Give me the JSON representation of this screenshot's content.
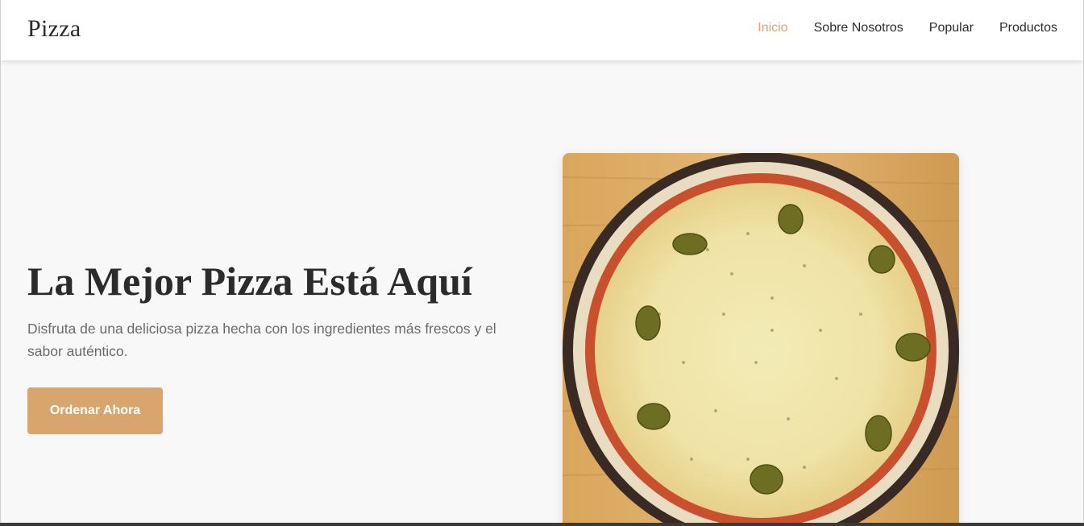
{
  "brand": {
    "logo_text": "Pizza"
  },
  "nav": {
    "items": [
      {
        "label": "Inicio",
        "active": true
      },
      {
        "label": "Sobre Nosotros",
        "active": false
      },
      {
        "label": "Popular",
        "active": false
      },
      {
        "label": "Productos",
        "active": false
      }
    ]
  },
  "hero": {
    "title": "La Mejor Pizza Está Aquí",
    "subtitle": "Disfruta de una deliciosa pizza hecha con los ingredientes más frescos y el sabor auténtico.",
    "cta_label": "Ordenar Ahora",
    "image_subject": "pizza with olives and oregano on wooden board"
  },
  "colors": {
    "accent": "#d8a56f",
    "text_dark": "#2b2b2b",
    "text_muted": "#6b6b6b",
    "background": "#f8f8f8",
    "header_bg": "#ffffff"
  }
}
